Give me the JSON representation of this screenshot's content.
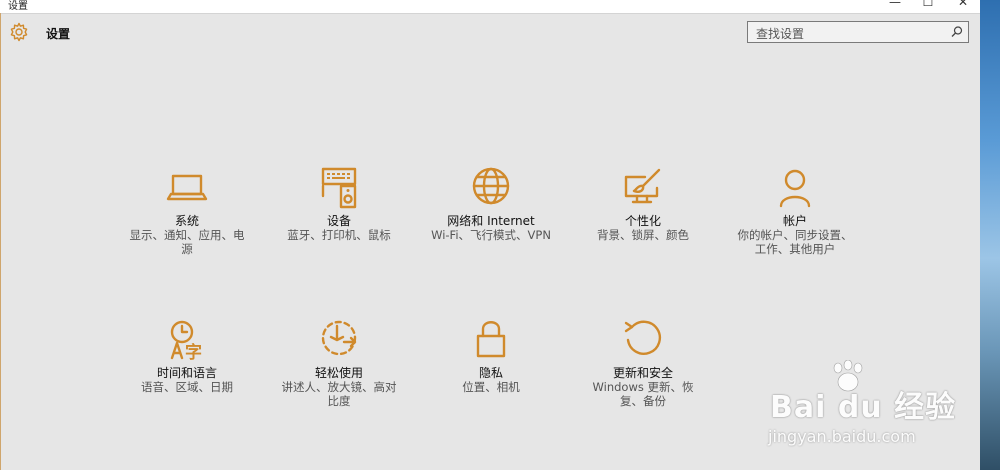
{
  "window": {
    "title": "设置",
    "minimize": "—",
    "maximize": "☐",
    "close": "✕"
  },
  "header": {
    "title": "设置",
    "icon": "gear-icon"
  },
  "search": {
    "placeholder": "查找设置",
    "icon": "search-icon"
  },
  "tiles": [
    {
      "name": "系统",
      "desc": "显示、通知、应用、电源",
      "icon": "laptop-icon"
    },
    {
      "name": "设备",
      "desc": "蓝牙、打印机、鼠标",
      "icon": "devices-icon"
    },
    {
      "name": "网络和 Internet",
      "desc": "Wi-Fi、飞行模式、VPN",
      "icon": "globe-icon"
    },
    {
      "name": "个性化",
      "desc": "背景、锁屏、颜色",
      "icon": "paint-icon"
    },
    {
      "name": "帐户",
      "desc": "你的帐户、同步设置、工作、其他用户",
      "icon": "person-icon"
    },
    {
      "name": "时间和语言",
      "desc": "语音、区域、日期",
      "icon": "time-language-icon"
    },
    {
      "name": "轻松使用",
      "desc": "讲述人、放大镜、高对比度",
      "icon": "ease-of-access-icon"
    },
    {
      "name": "隐私",
      "desc": "位置、相机",
      "icon": "lock-icon"
    },
    {
      "name": "更新和安全",
      "desc": "Windows 更新、恢复、备份",
      "icon": "update-icon"
    }
  ],
  "watermark": {
    "logo": "Bai du 经验",
    "url": "jingyan.baidu.com"
  },
  "colors": {
    "accent": "#d08a2c",
    "background": "#e6e6e6"
  }
}
